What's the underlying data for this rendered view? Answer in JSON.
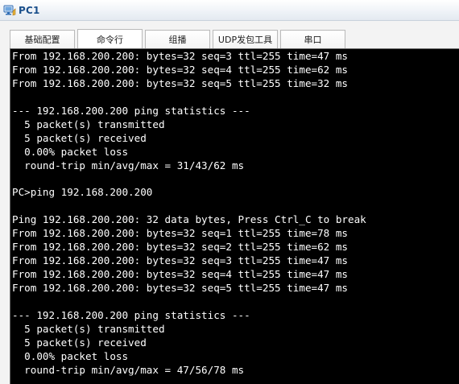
{
  "window": {
    "title": "PC1",
    "icon": "pc-icon"
  },
  "tabs": [
    {
      "label": "基础配置",
      "active": false
    },
    {
      "label": "命令行",
      "active": true
    },
    {
      "label": "组播",
      "active": false
    },
    {
      "label": "UDP发包工具",
      "active": false
    },
    {
      "label": "串口",
      "active": false
    }
  ],
  "terminal": {
    "lines": [
      "From 192.168.200.200: bytes=32 seq=3 ttl=255 time=47 ms",
      "From 192.168.200.200: bytes=32 seq=4 ttl=255 time=62 ms",
      "From 192.168.200.200: bytes=32 seq=5 ttl=255 time=32 ms",
      "",
      "--- 192.168.200.200 ping statistics ---",
      "  5 packet(s) transmitted",
      "  5 packet(s) received",
      "  0.00% packet loss",
      "  round-trip min/avg/max = 31/43/62 ms",
      "",
      "PC>ping 192.168.200.200",
      "",
      "Ping 192.168.200.200: 32 data bytes, Press Ctrl_C to break",
      "From 192.168.200.200: bytes=32 seq=1 ttl=255 time=78 ms",
      "From 192.168.200.200: bytes=32 seq=2 ttl=255 time=62 ms",
      "From 192.168.200.200: bytes=32 seq=3 ttl=255 time=47 ms",
      "From 192.168.200.200: bytes=32 seq=4 ttl=255 time=47 ms",
      "From 192.168.200.200: bytes=32 seq=5 ttl=255 time=47 ms",
      "",
      "--- 192.168.200.200 ping statistics ---",
      "  5 packet(s) transmitted",
      "  5 packet(s) received",
      "  0.00% packet loss",
      "  round-trip min/avg/max = 47/56/78 ms"
    ]
  },
  "colors": {
    "terminal_bg": "#000000",
    "terminal_fg": "#ffffff",
    "title_color": "#1a4f8b"
  }
}
